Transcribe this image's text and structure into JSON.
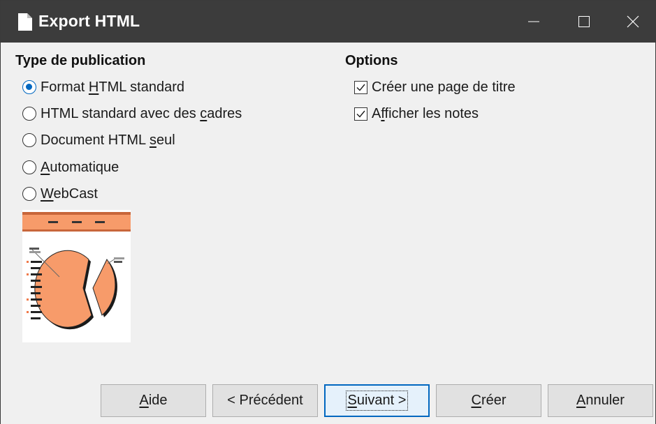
{
  "window": {
    "title": "Export HTML"
  },
  "type_section": {
    "title": "Type de publication",
    "options": [
      {
        "before": "Format ",
        "mnemonic": "H",
        "after": "TML standard",
        "checked": true
      },
      {
        "before": "HTML standard avec des ",
        "mnemonic": "c",
        "after": "adres",
        "checked": false
      },
      {
        "before": "Document HTML ",
        "mnemonic": "s",
        "after": "eul",
        "checked": false
      },
      {
        "before": "",
        "mnemonic": "A",
        "after": "utomatique",
        "checked": false
      },
      {
        "before": "",
        "mnemonic": "W",
        "after": "ebCast",
        "checked": false
      }
    ]
  },
  "options_section": {
    "title": "Options",
    "items": [
      {
        "before": "Créer une page de titre",
        "mnemonic": "",
        "after": "",
        "checked": true
      },
      {
        "before": "A",
        "mnemonic": "f",
        "after": "ficher les notes",
        "checked": true
      }
    ]
  },
  "buttons": {
    "help": {
      "before": "",
      "mnemonic": "A",
      "after": "ide"
    },
    "previous": {
      "before": "< Précédent",
      "mnemonic": "",
      "after": ""
    },
    "next": {
      "before": "",
      "mnemonic": "S",
      "after": "uivant >"
    },
    "create": {
      "before": "",
      "mnemonic": "C",
      "after": "réer"
    },
    "cancel": {
      "before": "",
      "mnemonic": "A",
      "after": "nnuler"
    }
  },
  "icons": {
    "title": "document-icon",
    "minimize": "minimize-icon",
    "maximize": "maximize-icon",
    "close": "close-icon",
    "preview": "pie-chart-preview-image"
  },
  "colors": {
    "titlebar": "#3c3c3c",
    "accent": "#0067c0",
    "preview_orange": "#f79b6a"
  }
}
